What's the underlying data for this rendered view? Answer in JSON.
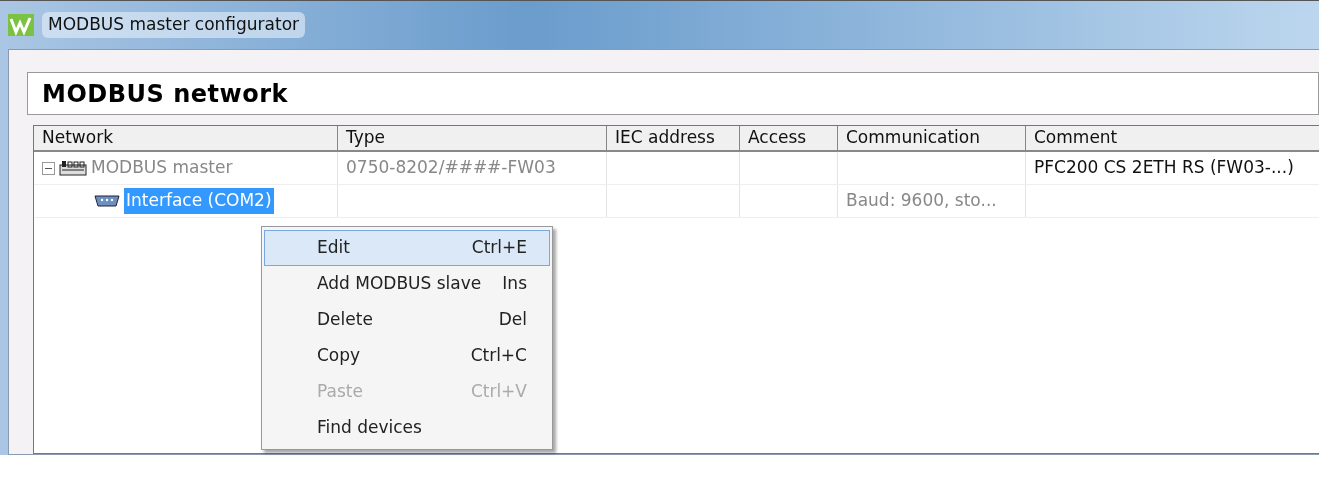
{
  "window": {
    "title": "MODBUS master configurator"
  },
  "header": {
    "title": "MODBUS network"
  },
  "table": {
    "columns": [
      "Network",
      "Type",
      "IEC address",
      "Access",
      "Communication",
      "Comment"
    ],
    "rows": [
      {
        "kind": "master",
        "expanded": true,
        "selected": false,
        "cells": [
          "MODBUS master",
          "0750-8202/####-FW03",
          "",
          "",
          "",
          "PFC200 CS 2ETH RS (FW03-...)"
        ],
        "children": [
          {
            "kind": "interface",
            "selected": true,
            "cells": [
              "Interface (COM2)",
              "",
              "",
              "",
              "Baud: 9600, sto...",
              ""
            ]
          }
        ]
      }
    ]
  },
  "context_menu": {
    "items": [
      {
        "label": "Edit",
        "shortcut": "Ctrl+E",
        "selected": true,
        "disabled": false
      },
      {
        "label": "Add MODBUS slave",
        "shortcut": "Ins",
        "selected": false,
        "disabled": false
      },
      {
        "label": "Delete",
        "shortcut": "Del",
        "selected": false,
        "disabled": false
      },
      {
        "label": "Copy",
        "shortcut": "Ctrl+C",
        "selected": false,
        "disabled": false
      },
      {
        "label": "Paste",
        "shortcut": "Ctrl+V",
        "selected": false,
        "disabled": true
      },
      {
        "label": "Find devices",
        "selected": false,
        "disabled": false
      }
    ]
  }
}
